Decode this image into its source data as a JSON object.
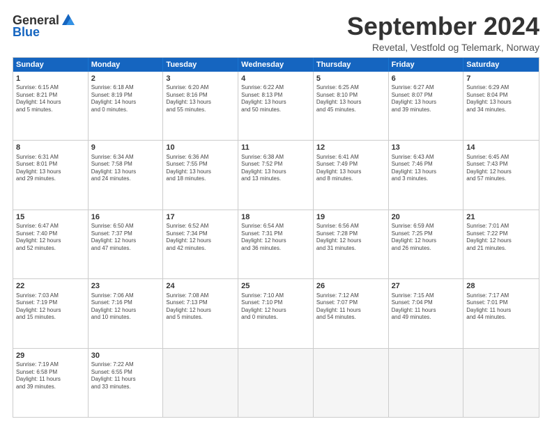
{
  "logo": {
    "general": "General",
    "blue": "Blue"
  },
  "title": "September 2024",
  "location": "Revetal, Vestfold og Telemark, Norway",
  "header": {
    "days": [
      "Sunday",
      "Monday",
      "Tuesday",
      "Wednesday",
      "Thursday",
      "Friday",
      "Saturday"
    ]
  },
  "weeks": [
    [
      {
        "day": "1",
        "info": "Sunrise: 6:15 AM\nSunset: 8:21 PM\nDaylight: 14 hours\nand 5 minutes."
      },
      {
        "day": "2",
        "info": "Sunrise: 6:18 AM\nSunset: 8:19 PM\nDaylight: 14 hours\nand 0 minutes."
      },
      {
        "day": "3",
        "info": "Sunrise: 6:20 AM\nSunset: 8:16 PM\nDaylight: 13 hours\nand 55 minutes."
      },
      {
        "day": "4",
        "info": "Sunrise: 6:22 AM\nSunset: 8:13 PM\nDaylight: 13 hours\nand 50 minutes."
      },
      {
        "day": "5",
        "info": "Sunrise: 6:25 AM\nSunset: 8:10 PM\nDaylight: 13 hours\nand 45 minutes."
      },
      {
        "day": "6",
        "info": "Sunrise: 6:27 AM\nSunset: 8:07 PM\nDaylight: 13 hours\nand 39 minutes."
      },
      {
        "day": "7",
        "info": "Sunrise: 6:29 AM\nSunset: 8:04 PM\nDaylight: 13 hours\nand 34 minutes."
      }
    ],
    [
      {
        "day": "8",
        "info": "Sunrise: 6:31 AM\nSunset: 8:01 PM\nDaylight: 13 hours\nand 29 minutes."
      },
      {
        "day": "9",
        "info": "Sunrise: 6:34 AM\nSunset: 7:58 PM\nDaylight: 13 hours\nand 24 minutes."
      },
      {
        "day": "10",
        "info": "Sunrise: 6:36 AM\nSunset: 7:55 PM\nDaylight: 13 hours\nand 18 minutes."
      },
      {
        "day": "11",
        "info": "Sunrise: 6:38 AM\nSunset: 7:52 PM\nDaylight: 13 hours\nand 13 minutes."
      },
      {
        "day": "12",
        "info": "Sunrise: 6:41 AM\nSunset: 7:49 PM\nDaylight: 13 hours\nand 8 minutes."
      },
      {
        "day": "13",
        "info": "Sunrise: 6:43 AM\nSunset: 7:46 PM\nDaylight: 13 hours\nand 3 minutes."
      },
      {
        "day": "14",
        "info": "Sunrise: 6:45 AM\nSunset: 7:43 PM\nDaylight: 12 hours\nand 57 minutes."
      }
    ],
    [
      {
        "day": "15",
        "info": "Sunrise: 6:47 AM\nSunset: 7:40 PM\nDaylight: 12 hours\nand 52 minutes."
      },
      {
        "day": "16",
        "info": "Sunrise: 6:50 AM\nSunset: 7:37 PM\nDaylight: 12 hours\nand 47 minutes."
      },
      {
        "day": "17",
        "info": "Sunrise: 6:52 AM\nSunset: 7:34 PM\nDaylight: 12 hours\nand 42 minutes."
      },
      {
        "day": "18",
        "info": "Sunrise: 6:54 AM\nSunset: 7:31 PM\nDaylight: 12 hours\nand 36 minutes."
      },
      {
        "day": "19",
        "info": "Sunrise: 6:56 AM\nSunset: 7:28 PM\nDaylight: 12 hours\nand 31 minutes."
      },
      {
        "day": "20",
        "info": "Sunrise: 6:59 AM\nSunset: 7:25 PM\nDaylight: 12 hours\nand 26 minutes."
      },
      {
        "day": "21",
        "info": "Sunrise: 7:01 AM\nSunset: 7:22 PM\nDaylight: 12 hours\nand 21 minutes."
      }
    ],
    [
      {
        "day": "22",
        "info": "Sunrise: 7:03 AM\nSunset: 7:19 PM\nDaylight: 12 hours\nand 15 minutes."
      },
      {
        "day": "23",
        "info": "Sunrise: 7:06 AM\nSunset: 7:16 PM\nDaylight: 12 hours\nand 10 minutes."
      },
      {
        "day": "24",
        "info": "Sunrise: 7:08 AM\nSunset: 7:13 PM\nDaylight: 12 hours\nand 5 minutes."
      },
      {
        "day": "25",
        "info": "Sunrise: 7:10 AM\nSunset: 7:10 PM\nDaylight: 12 hours\nand 0 minutes."
      },
      {
        "day": "26",
        "info": "Sunrise: 7:12 AM\nSunset: 7:07 PM\nDaylight: 11 hours\nand 54 minutes."
      },
      {
        "day": "27",
        "info": "Sunrise: 7:15 AM\nSunset: 7:04 PM\nDaylight: 11 hours\nand 49 minutes."
      },
      {
        "day": "28",
        "info": "Sunrise: 7:17 AM\nSunset: 7:01 PM\nDaylight: 11 hours\nand 44 minutes."
      }
    ],
    [
      {
        "day": "29",
        "info": "Sunrise: 7:19 AM\nSunset: 6:58 PM\nDaylight: 11 hours\nand 39 minutes."
      },
      {
        "day": "30",
        "info": "Sunrise: 7:22 AM\nSunset: 6:55 PM\nDaylight: 11 hours\nand 33 minutes."
      },
      {
        "day": "",
        "info": ""
      },
      {
        "day": "",
        "info": ""
      },
      {
        "day": "",
        "info": ""
      },
      {
        "day": "",
        "info": ""
      },
      {
        "day": "",
        "info": ""
      }
    ]
  ]
}
